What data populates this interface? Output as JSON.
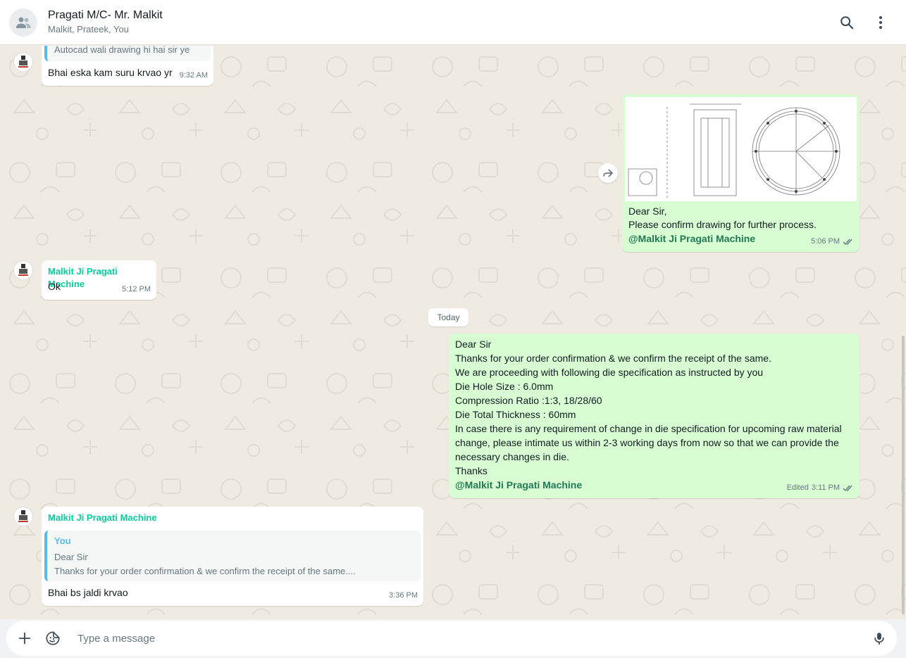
{
  "header": {
    "title": "Pragati M/C- Mr. Malkit",
    "subtitle": "Malkit, Prateek, You"
  },
  "messages": {
    "m1": {
      "quote_text": "Autocad wali drawing hi hai sir ye",
      "text": "Bhai eska kam suru krvao yr",
      "time": "9:32 AM"
    },
    "m2": {
      "line1": "Dear Sir,",
      "line2": "Please confirm drawing for further process.",
      "mention": "@Malkit Ji Pragati Machine",
      "time": "5:06 PM"
    },
    "m3": {
      "sender": "Malkit Ji Pragati Machine",
      "text": "Ok",
      "time": "5:12 PM"
    },
    "date_divider": "Today",
    "m4": {
      "lines": [
        "Dear Sir",
        "Thanks for your order confirmation & we confirm the receipt of the same.",
        "We are proceeding with following die specification as instructed by you",
        "Die Hole Size : 6.0mm",
        "Compression Ratio :1:3, 18/28/60",
        "Die Total Thickness : 60mm",
        "In case there is any requirement of change in die specification for upcoming raw material",
        "change, please intimate us within 2-3 working days from now so that we can provide the",
        "necessary changes in die.",
        "Thanks"
      ],
      "mention": "@Malkit Ji Pragati Machine",
      "edited": "Edited",
      "time": "3:11 PM"
    },
    "m5": {
      "sender": "Malkit Ji Pragati Machine",
      "quote_author": "You",
      "quote_line1": "Dear Sir",
      "quote_line2": "Thanks for your order confirmation & we confirm the receipt of the same....",
      "text": "Bhai bs jaldi krvao",
      "time": "3:36 PM"
    }
  },
  "composer": {
    "placeholder": "Type a message"
  },
  "colors": {
    "chat_bg": "#efeae2",
    "outgoing_bubble": "#d9fdd3",
    "incoming_bubble": "#ffffff",
    "sender_name": "#06cf9c",
    "mention": "#1f7a54",
    "quote_bar": "#53bdeb"
  }
}
